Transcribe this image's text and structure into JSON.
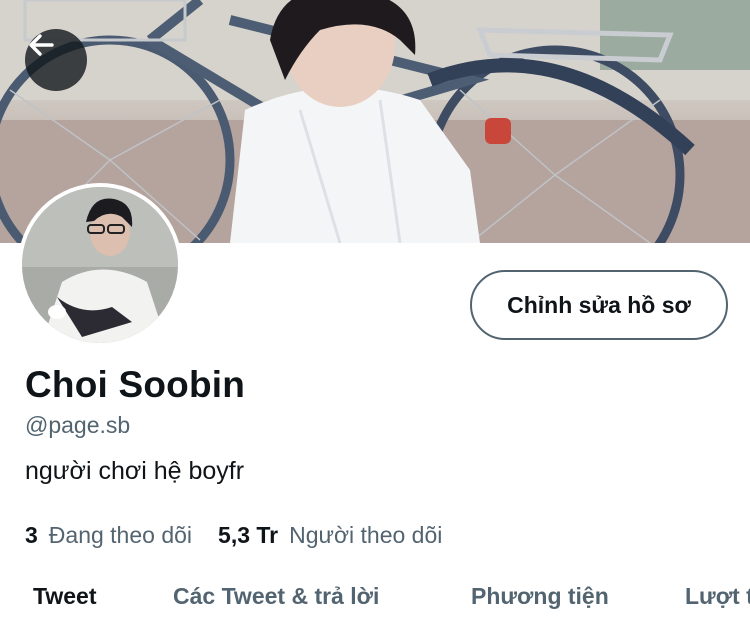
{
  "header": {
    "back_icon": "arrow-left-icon"
  },
  "profile": {
    "edit_button_label": "Chỉnh sửa hồ sơ",
    "name": "Choi Soobin",
    "handle": "@page.sb",
    "bio": "người chơi hệ boyfr",
    "following_count": "3",
    "following_label": "Đang theo dõi",
    "followers_count": "5,3 Tr",
    "followers_label": "Người theo dõi"
  },
  "tabs": [
    {
      "label": "Tweet",
      "active": true
    },
    {
      "label": "Các Tweet & trả lời",
      "active": false
    },
    {
      "label": "Phương tiện",
      "active": false
    },
    {
      "label": "Lượt thích",
      "active": false
    }
  ],
  "colors": {
    "text_primary": "#0f1419",
    "text_secondary": "#536471"
  }
}
